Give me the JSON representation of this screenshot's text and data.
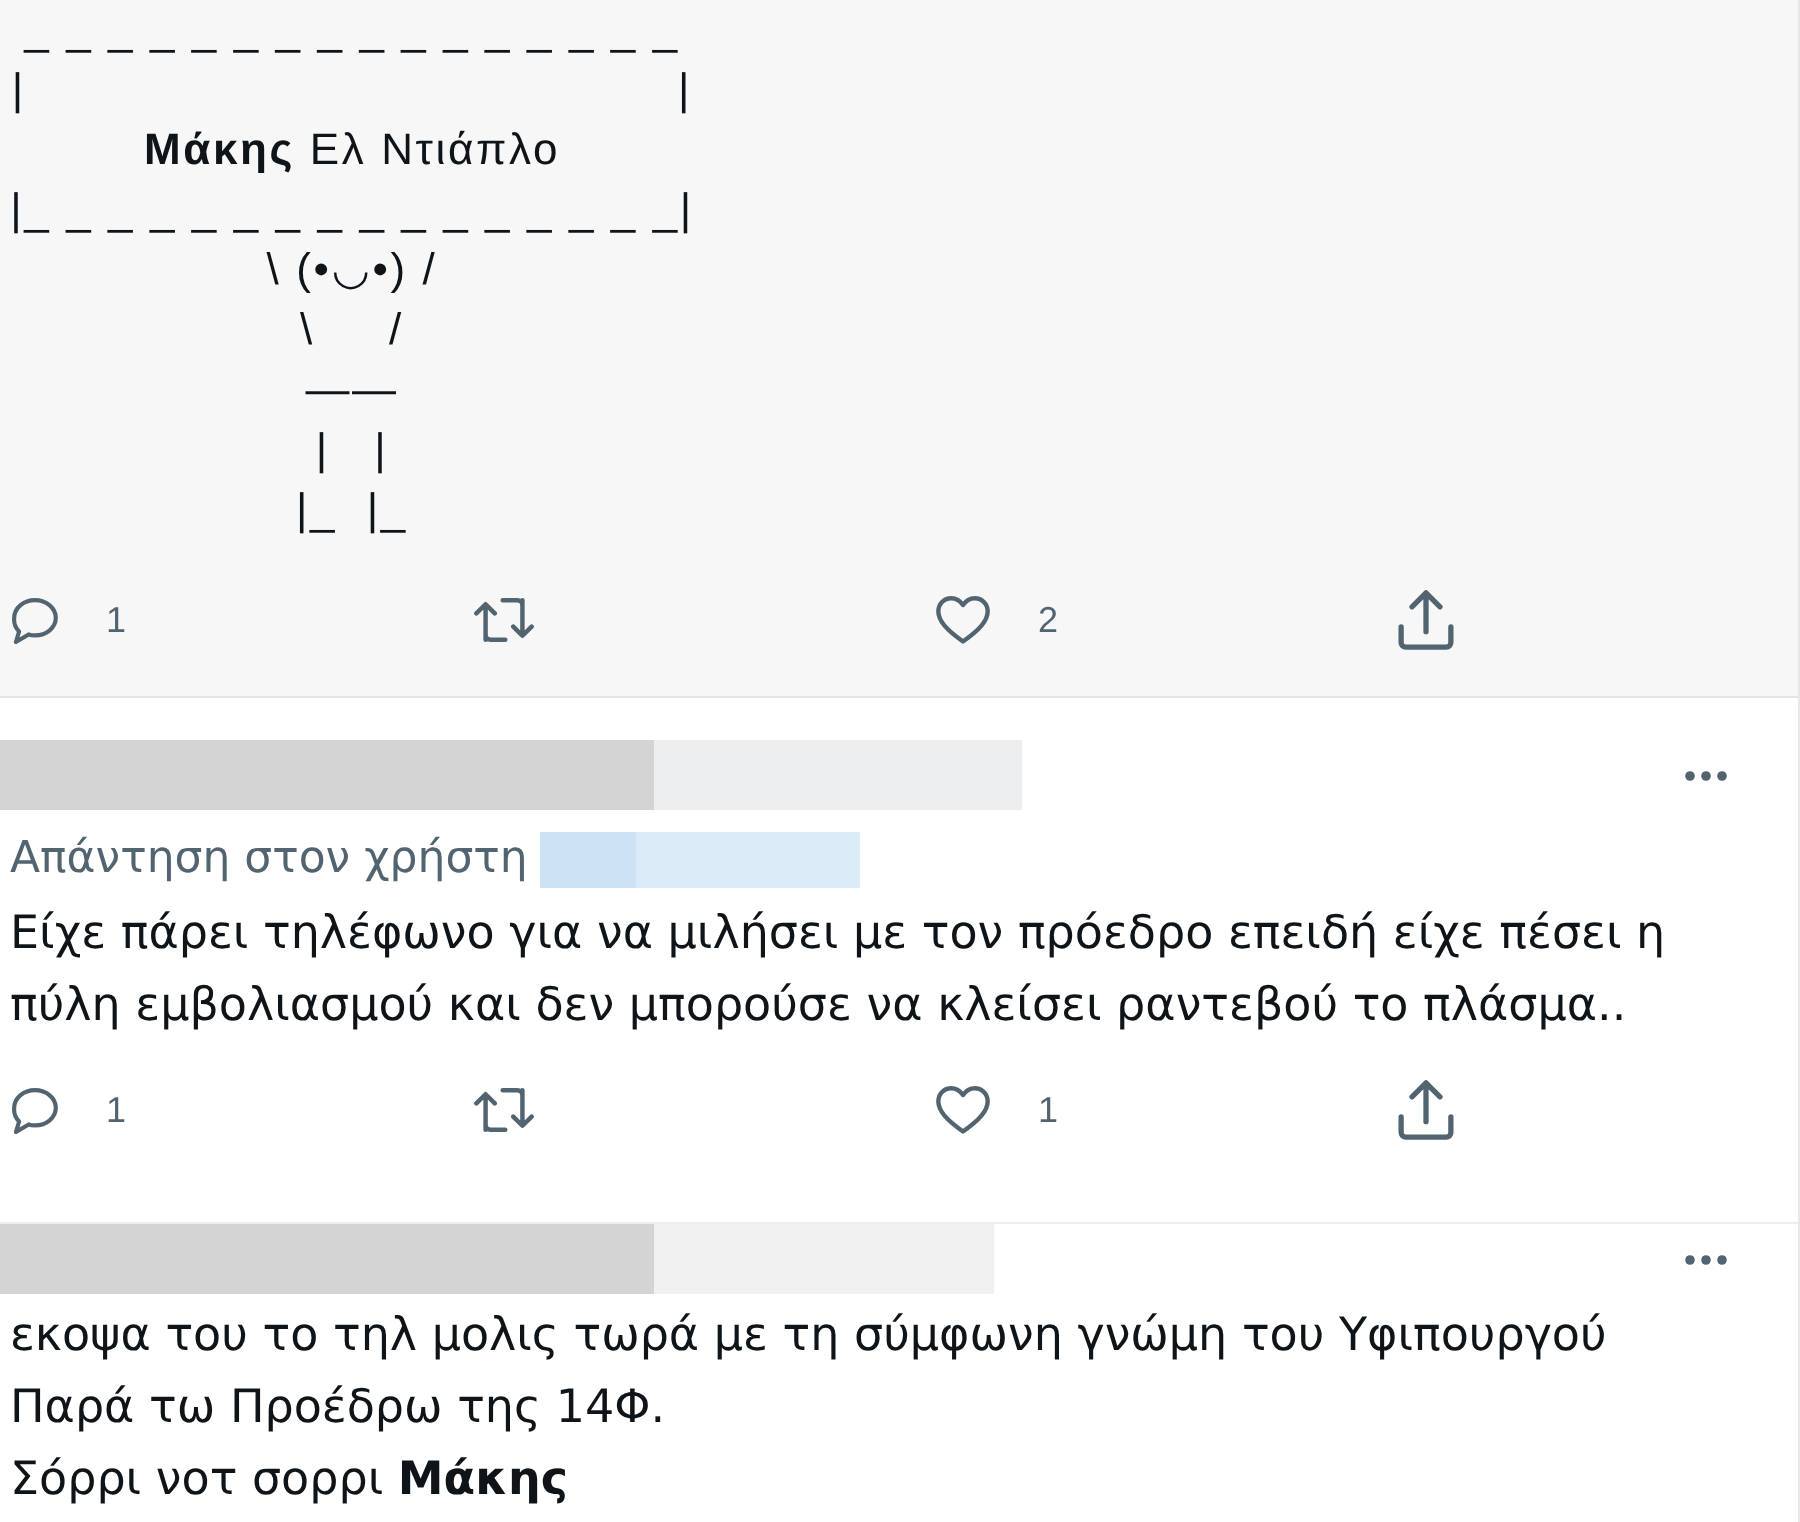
{
  "tweets": [
    {
      "highlighted": true,
      "author_redacted": false,
      "art_lines": [
        "_ _ _ _ _ _ _ _ _ _ _ _ _ _ _ _",
        "|                                            |",
        "**Μάκης** Ελ Ντιάπλο",
        "|_ _ _ _ _ _ _ _ _ _ _ _ _ _ _ _|",
        "\\ (•◡•) /",
        "\\     /",
        "——",
        "|   |",
        "|_  |_"
      ],
      "actions": [
        {
          "kind": "reply",
          "count": "1"
        },
        {
          "kind": "retweet"
        },
        {
          "kind": "like",
          "count": "2"
        },
        {
          "kind": "share"
        }
      ]
    },
    {
      "highlighted": false,
      "author_redacted": true,
      "reply_to": {
        "label": "Απάντηση στον χρήστη",
        "handle_redacted": true
      },
      "text": "Είχε πάρει τηλέφωνο για να μιλήσει με τον πρόεδρο επειδή είχε πέσει η\nπύλη εμβολιασμού και δεν μπορούσε να κλείσει ραντεβού το πλάσμα..",
      "actions": [
        {
          "kind": "reply",
          "count": "1"
        },
        {
          "kind": "retweet"
        },
        {
          "kind": "like",
          "count": "1"
        },
        {
          "kind": "share"
        }
      ]
    },
    {
      "highlighted": false,
      "author_redacted": true,
      "text": "εκοψα του το τηλ μολις τωρά με τη σύμφωνη γνώμη του Υφιπουργού\nΠαρά τω Προέδρω της 14Φ.\nΣόρρι νοτ σορρι **Μάκης**"
    }
  ]
}
